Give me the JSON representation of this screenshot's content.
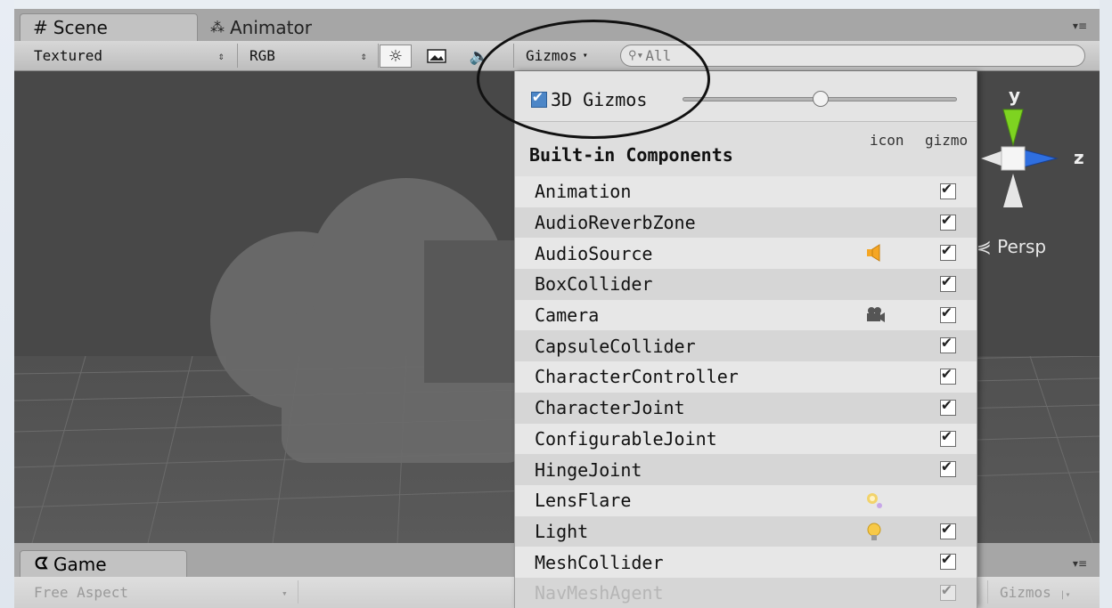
{
  "scene_panel": {
    "tabs": [
      {
        "label": "Scene",
        "icon": "hash-icon"
      },
      {
        "label": "Animator",
        "icon": "animator-icon"
      }
    ],
    "toolbar": {
      "draw_mode": "Textured",
      "render_mode": "RGB",
      "gizmos_label": "Gizmos",
      "search_placeholder": "All"
    },
    "axis_gizmo": {
      "y": "y",
      "z": "z"
    },
    "projection_label": "Persp"
  },
  "gizmos_dropdown": {
    "toggle_3d_label": "3D Gizmos",
    "toggle_3d_checked": true,
    "icon_size_slider_value": 0.5,
    "column_icon": "icon",
    "column_gizmo": "gizmo",
    "section_title": "Built-in Components",
    "rows": [
      {
        "name": "Animation",
        "icon": "",
        "gizmo": true
      },
      {
        "name": "AudioReverbZone",
        "icon": "",
        "gizmo": true
      },
      {
        "name": "AudioSource",
        "icon": "speaker-icon",
        "gizmo": true
      },
      {
        "name": "BoxCollider",
        "icon": "",
        "gizmo": true
      },
      {
        "name": "Camera",
        "icon": "camera-icon",
        "gizmo": true
      },
      {
        "name": "CapsuleCollider",
        "icon": "",
        "gizmo": true
      },
      {
        "name": "CharacterController",
        "icon": "",
        "gizmo": true
      },
      {
        "name": "CharacterJoint",
        "icon": "",
        "gizmo": true
      },
      {
        "name": "ConfigurableJoint",
        "icon": "",
        "gizmo": true
      },
      {
        "name": "HingeJoint",
        "icon": "",
        "gizmo": true
      },
      {
        "name": "LensFlare",
        "icon": "lensflare-icon",
        "gizmo": false
      },
      {
        "name": "Light",
        "icon": "lightbulb-icon",
        "gizmo": true
      },
      {
        "name": "MeshCollider",
        "icon": "",
        "gizmo": true
      },
      {
        "name": "NavMeshAgent",
        "icon": "",
        "gizmo": true
      }
    ]
  },
  "game_panel": {
    "tab_label": "Game",
    "aspect_label": "Free Aspect",
    "gizmos_label": "Gizmos"
  },
  "colors": {
    "viewport_bg": "#484848",
    "check_blue": "#4c86c7",
    "axis_y": "#7ed321",
    "axis_z": "#2f6fe0"
  }
}
